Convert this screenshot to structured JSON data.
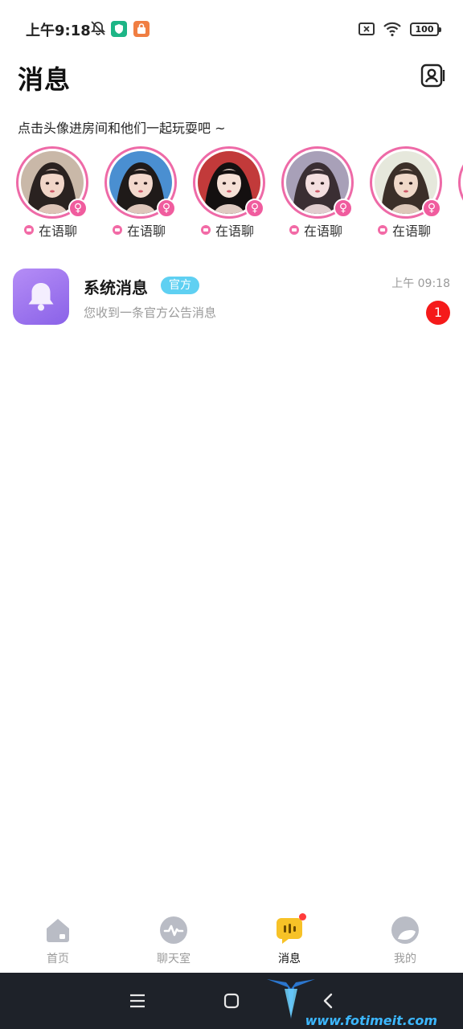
{
  "status_bar": {
    "time": "上午9:18",
    "battery": "100",
    "icons": [
      "bell-mute-icon",
      "shield-icon",
      "shopping-bag-icon",
      "close-box-icon",
      "wifi-icon",
      "battery-icon"
    ]
  },
  "header": {
    "title": "消息",
    "contacts_icon": "contacts-icon"
  },
  "hint": "点击头像进房间和他们一起玩耍吧 ~",
  "avatars": [
    {
      "status": "在语聊",
      "gender": "♀",
      "skin": "#f1d6c8",
      "hair": "#2a2220",
      "bg": "#c9b8a8"
    },
    {
      "status": "在语聊",
      "gender": "♀",
      "skin": "#f3d9cd",
      "hair": "#1f1a19",
      "bg": "#4a8fd1"
    },
    {
      "status": "在语聊",
      "gender": "♀",
      "skin": "#f5e0d6",
      "hair": "#141010",
      "bg": "#c23a3a"
    },
    {
      "status": "在语聊",
      "gender": "♀",
      "skin": "#f4dfe0",
      "hair": "#3a2e33",
      "bg": "#a8a0b8"
    },
    {
      "status": "在语聊",
      "gender": "♀",
      "skin": "#f0d9c9",
      "hair": "#3b2f28",
      "bg": "#e6e8dc"
    }
  ],
  "message": {
    "title": "系统消息",
    "tag": "官方",
    "time": "上午 09:18",
    "preview": "您收到一条官方公告消息",
    "unread": "1",
    "icon": "bell-icon"
  },
  "nav": {
    "items": [
      {
        "label": "首页",
        "icon": "home-icon"
      },
      {
        "label": "聊天室",
        "icon": "chatroom-icon"
      },
      {
        "label": "消息",
        "icon": "message-icon"
      },
      {
        "label": "我的",
        "icon": "profile-icon"
      }
    ]
  },
  "watermark": {
    "url": "www.fotimeit.com"
  },
  "colors": {
    "accent_pink": "#ee6aa7",
    "badge_red": "#f51a1a",
    "tag_blue": "#5fd0f2",
    "message_icon_purple": "#9a72ee",
    "nav_active_yellow": "#f7c227"
  }
}
